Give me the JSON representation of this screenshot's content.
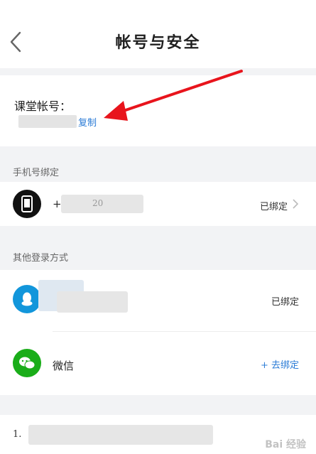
{
  "header": {
    "title": "帐号与安全"
  },
  "account": {
    "label": "课堂帐号：",
    "copy_label": "复制"
  },
  "phone_section": {
    "title": "手机号绑定",
    "phone_prefix": "+",
    "phone_partial": "20",
    "status": "已绑定"
  },
  "other_section": {
    "title": "其他登录方式",
    "qq": {
      "status": "已绑定"
    },
    "wechat": {
      "name": "微信",
      "bind_label": "+ 去绑定"
    }
  },
  "bottom": {
    "item_number": "1."
  },
  "watermark": "Bai 经验",
  "colors": {
    "link": "#2a7bd6",
    "qq": "#1296db",
    "wechat": "#1aad19",
    "arrow": "#e8141c"
  }
}
